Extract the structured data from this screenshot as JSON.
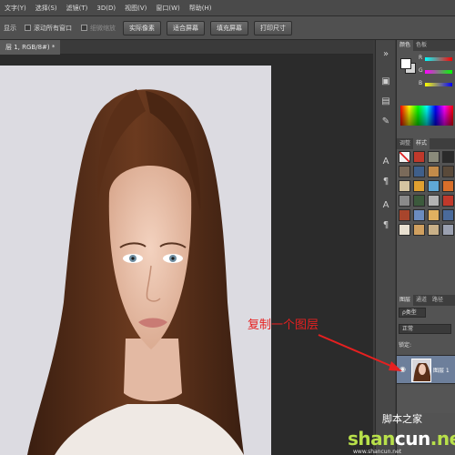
{
  "menubar": {
    "items": [
      "文字(Y)",
      "选择(S)",
      "滤镜(T)",
      "3D(D)",
      "视图(V)",
      "窗口(W)",
      "帮助(H)"
    ]
  },
  "options": {
    "show_label": "显示",
    "scroll_all": "滚动所有窗口",
    "scrubby_zoom": "细微缩放",
    "actual_pixels": "实际像素",
    "fit_screen": "适合屏幕",
    "fill_screen": "填充屏幕",
    "print_size": "打印尺寸"
  },
  "document": {
    "tab_label": "层 1, RGB/8#) *"
  },
  "panels": {
    "color_tab": "颜色",
    "swatches_tab": "色板",
    "adjust_tab": "调整",
    "styles_tab": "样式",
    "layers_tab": "图层",
    "channels_tab": "通道",
    "paths_tab": "路径",
    "slider_r": "R",
    "slider_g": "G",
    "slider_b": "B",
    "kind_filter": "ρ类型",
    "blend_mode": "正常",
    "lock_label": "锁定:",
    "layer_name": "图层 1",
    "fg_color": "#ffffff",
    "bg_color": "#d6d6d6"
  },
  "annotation": {
    "text": "复制一个图层",
    "color": "#e62020"
  },
  "watermark": {
    "script_text": "脚本之家",
    "brand_left": "shan",
    "brand_right": "cun",
    "brand_suffix": ".net",
    "sub_text": "www.shancun.net"
  }
}
